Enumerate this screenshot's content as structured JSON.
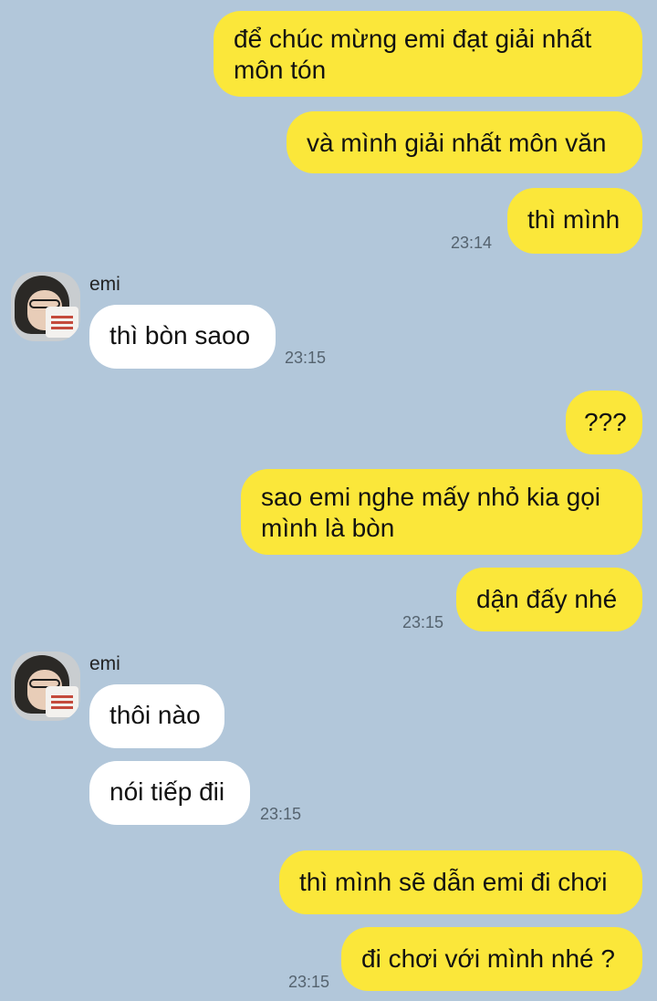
{
  "messages": {
    "m1": {
      "text": "để chúc mừng emi đạt giải nhất\nmôn tón"
    },
    "m2": {
      "text": "và mình giải nhất môn văn"
    },
    "m3": {
      "text": "thì mình",
      "time": "23:14"
    },
    "m4": {
      "sender": "emi",
      "text": "thì bòn saoo",
      "time": "23:15"
    },
    "m5": {
      "text": "???"
    },
    "m6": {
      "text": "sao emi nghe mấy nhỏ kia gọi\nmình là bòn"
    },
    "m7": {
      "text": "dận đấy nhé",
      "time": "23:15"
    },
    "m8": {
      "sender": "emi",
      "text": "thôi nào"
    },
    "m9": {
      "text": "nói tiếp đii",
      "time": "23:15"
    },
    "m10": {
      "text": "thì mình sẽ dẫn emi đi chơi"
    },
    "m11": {
      "text": "đi chơi với mình nhé ?",
      "time": "23:15"
    }
  },
  "colors": {
    "background": "#b2c7da",
    "outgoing_bubble": "#fbe73a",
    "incoming_bubble": "#ffffff",
    "timestamp": "#55636f"
  }
}
